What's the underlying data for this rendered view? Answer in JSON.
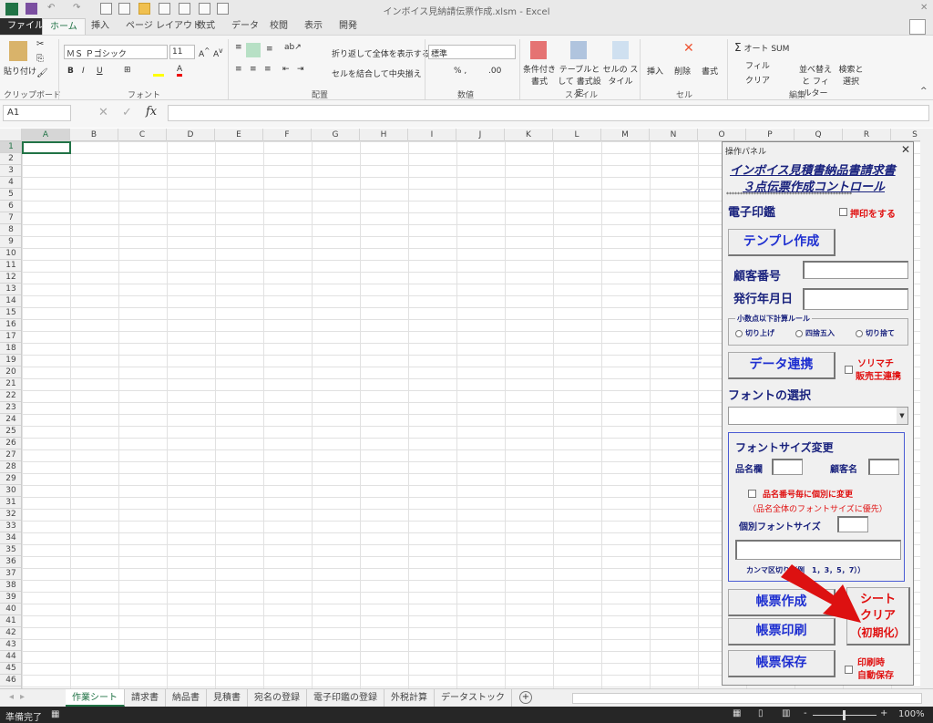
{
  "window": {
    "title": "インボイス見納請伝票作成.xlsm - Excel"
  },
  "ribbon_tabs": [
    "ファイル",
    "ホーム",
    "挿入",
    "ページ レイアウト",
    "数式",
    "データ",
    "校閲",
    "表示",
    "開発"
  ],
  "ribbon": {
    "clipboard": {
      "paste": "貼り付け",
      "group": "クリップボード"
    },
    "font": {
      "name": "ＭＳ Ｐゴシック",
      "size": "11",
      "group": "フォント"
    },
    "alignment": {
      "wrap": "折り返して全体を表示する",
      "merge": "セルを結合して中央揃え",
      "group": "配置"
    },
    "number": {
      "format": "標準",
      "group": "数値"
    },
    "styles": {
      "conditional": "条件付き 書式",
      "table": "テーブルとして 書式設定",
      "cell": "セルの スタイル",
      "group": "スタイル"
    },
    "cells": {
      "insert": "挿入",
      "delete": "削除",
      "format": "書式",
      "group": "セル"
    },
    "editing": {
      "autosum": "オート SUM",
      "fill": "フィル",
      "clear": "クリア",
      "sort": "並べ替えと フィルター",
      "find": "検索と 選択",
      "group": "編集"
    }
  },
  "formula_bar": {
    "name_box": "A1",
    "fx": "fx",
    "value": ""
  },
  "columns": [
    "A",
    "B",
    "C",
    "D",
    "E",
    "F",
    "G",
    "H",
    "I",
    "J",
    "K",
    "L",
    "M",
    "N",
    "O",
    "P",
    "Q",
    "R",
    "S"
  ],
  "rows": [
    "1",
    "2",
    "3",
    "4",
    "5",
    "6",
    "7",
    "8",
    "9",
    "10",
    "11",
    "12",
    "13",
    "14",
    "15",
    "16",
    "17",
    "18",
    "19",
    "20",
    "21",
    "22",
    "23",
    "24",
    "25",
    "26",
    "27",
    "28",
    "29",
    "30",
    "31",
    "32",
    "33",
    "34",
    "35",
    "36",
    "37",
    "38",
    "39",
    "40",
    "41",
    "42",
    "43",
    "44",
    "45",
    "46"
  ],
  "sheet_tabs": [
    "作業シート",
    "請求書",
    "納品書",
    "見積書",
    "宛名の登録",
    "電子印鑑の登録",
    "外税計算",
    "データストック"
  ],
  "active_sheet": "作業シート",
  "status": {
    "ready": "準備完了",
    "zoom": "100%"
  },
  "panel": {
    "title": "操作パネル",
    "heading1": "インボイス見積書納品書請求書",
    "heading2": "３点伝票作成コントロール",
    "stars": "**********************************************",
    "stamp_label": "電子印鑑",
    "stamp_check": "押印をする",
    "template_button": "テンプレ作成",
    "customer_no_label": "顧客番号",
    "customer_no_value": "",
    "issue_date_label": "発行年月日",
    "issue_date_value": "",
    "rounding_group": "小数点以下計算ルール",
    "rounding_options": [
      "切り上げ",
      "四捨五入",
      "切り捨て"
    ],
    "data_link_button": "データ連携",
    "link_check_1": "ソリマチ",
    "link_check_2": "販売王連携",
    "font_select_label": "フォントの選択",
    "font_select_value": "",
    "fontsize_heading": "フォントサイズ変更",
    "item_col_label": "品名欄",
    "customer_name_label": "顧客名",
    "individual_check": "品名番号毎に個別に変更",
    "individual_note": "（品名全体のフォントサイズに優先）",
    "individual_size_label": "個別フォントサイズ",
    "comma_note": "カンマ区切り（例　1，3，5，7））",
    "create_button": "帳票作成",
    "print_button": "帳票印刷",
    "save_button": "帳票保存",
    "clear_button_1": "シート",
    "clear_button_2": "クリア",
    "clear_button_3": "（初期化）",
    "autosave_1": "印刷時",
    "autosave_2": "自動保存"
  },
  "colors": {
    "excel_green": "#217346",
    "panel_blue": "#1e2fd0",
    "panel_red": "#e01010",
    "arrow_red": "#dd1111"
  }
}
